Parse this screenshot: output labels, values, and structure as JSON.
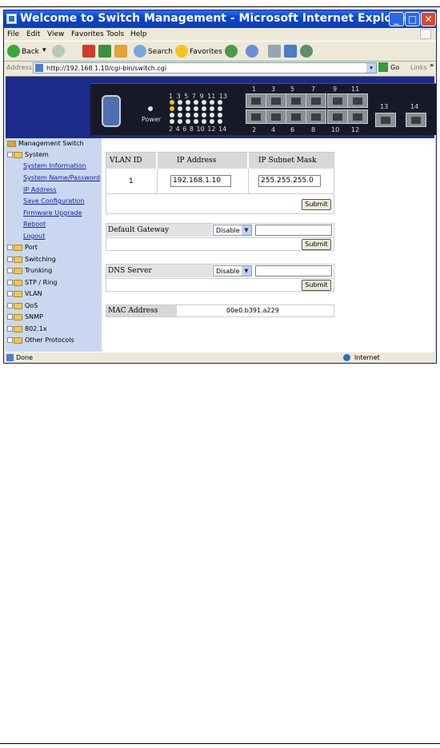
{
  "window": {
    "title": "Welcome to Switch Management - Microsoft Internet Explorer"
  },
  "menu": [
    "File",
    "Edit",
    "View",
    "Favorites",
    "Tools",
    "Help"
  ],
  "toolbar": {
    "back": "Back",
    "search": "Search",
    "favorites": "Favorites"
  },
  "address": {
    "label": "Address",
    "url": "http://192.168.1.10/cgi-bin/switch.cgi",
    "go": "Go",
    "links": "Links"
  },
  "banner": {
    "power_label": "Power",
    "led_top_numbers": "1 3 5 7 9 11 13",
    "led_bottom_numbers": "2 4 6 8 10 12 14",
    "ports_top": [
      "1",
      "3",
      "5",
      "7",
      "9",
      "11"
    ],
    "ports_bottom": [
      "2",
      "4",
      "6",
      "8",
      "10",
      "12"
    ],
    "ports_uplink": [
      "13",
      "14"
    ]
  },
  "nav": {
    "root": "Management Switch",
    "system": "System",
    "system_items": [
      "System Information",
      "System Name/Password",
      "IP Address",
      "Save Configuration",
      "Firmware Upgrade",
      "Reboot",
      "Logout"
    ],
    "groups": [
      "Port",
      "Switching",
      "Trunking",
      "STP / Ring",
      "VLAN",
      "QoS",
      "SNMP",
      "802.1x",
      "Other Protocols"
    ]
  },
  "ip_table": {
    "headers": [
      "VLAN ID",
      "IP Address",
      "IP Subnet Mask"
    ],
    "vlan_id": "1",
    "ip_address": "192.168.1.10",
    "subnet_mask": "255.255.255.0",
    "submit": "Submit"
  },
  "gateway": {
    "label": "Default Gateway",
    "mode": "Disable",
    "submit": "Submit"
  },
  "dns": {
    "label": "DNS Server",
    "mode": "Disable",
    "submit": "Submit"
  },
  "mac": {
    "label": "MAC Address",
    "value": "00e0.b391.a229"
  },
  "status": {
    "left": "Done",
    "right": "Internet"
  },
  "colors": {
    "titlebar": "#0845d1",
    "banner": "#1c2a8a",
    "nav_bg": "#c9d8f0",
    "led_on": "#f2c018"
  }
}
